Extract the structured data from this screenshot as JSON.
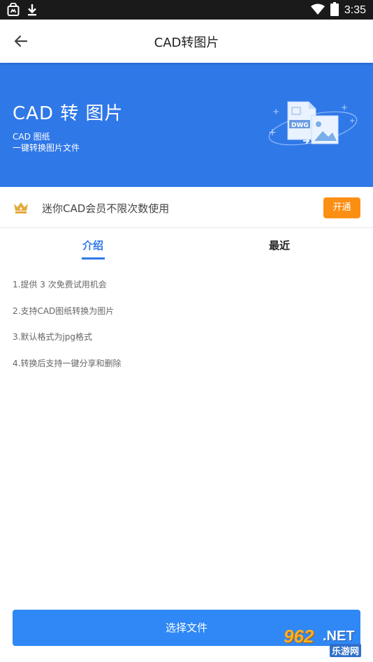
{
  "status_bar": {
    "time": "3:35",
    "icons": [
      "bag-icon",
      "download-icon",
      "wifi-icon",
      "battery-icon"
    ]
  },
  "app_bar": {
    "title": "CAD转图片",
    "back_icon": "back-arrow-icon"
  },
  "banner": {
    "title": "CAD 转 图片",
    "subtitle_line1": "CAD 图纸",
    "subtitle_line2": "一键转换图片文件",
    "illustration_label": "DWG",
    "background_color": "#2f78e8"
  },
  "vip": {
    "icon": "crown-icon",
    "text": "迷你CAD会员不限次数使用",
    "button_label": "开通",
    "button_color": "#fb8f14"
  },
  "tabs": [
    {
      "label": "介绍",
      "active": true
    },
    {
      "label": "最近",
      "active": false
    }
  ],
  "intro_items": [
    "1.提供 3 次免费试用机会",
    "2.支持CAD图纸转换为图片",
    "3.默认格式为jpg格式",
    "4.转换后支持一键分享和删除"
  ],
  "action": {
    "select_file_label": "选择文件",
    "button_color": "#2f88f5"
  },
  "watermark": {
    "number": "962",
    "suffix": ".NET",
    "name": "乐游网"
  }
}
